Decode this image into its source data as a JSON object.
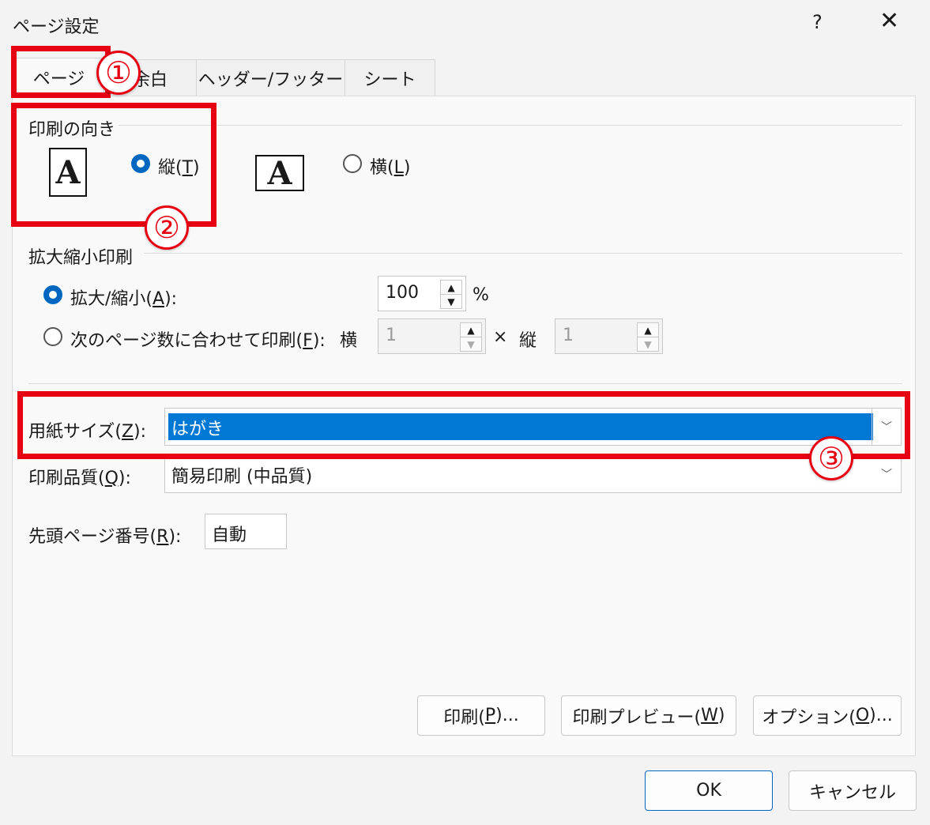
{
  "window": {
    "title": "ページ設定",
    "help": "?",
    "close": "✕"
  },
  "tabs": [
    {
      "label": "ページ"
    },
    {
      "label": "余白"
    },
    {
      "label": "ヘッダー/フッター"
    },
    {
      "label": "シート"
    }
  ],
  "orientation": {
    "section_label": "印刷の向き",
    "portrait_label": "縦(",
    "portrait_key": "T",
    "portrait_suffix": ")",
    "landscape_label": "横(",
    "landscape_key": "L",
    "landscape_suffix": ")",
    "icon_letter": "A"
  },
  "scaling": {
    "section_label": "拡大縮小印刷",
    "adjust_label": "拡大/縮小(",
    "adjust_key": "A",
    "adjust_suffix": "):",
    "adjust_value": "100",
    "percent": "%",
    "fit_label": "次のページ数に合わせて印刷(",
    "fit_key": "F",
    "fit_suffix": "):",
    "fit_wide_label": "横",
    "fit_wide_value": "1",
    "times": "×",
    "fit_tall_label": "縦",
    "fit_tall_value": "1"
  },
  "paper": {
    "size_label": "用紙サイズ(",
    "size_key": "Z",
    "size_suffix": "):",
    "size_value": "はがき",
    "quality_label": "印刷品質(",
    "quality_key": "Q",
    "quality_suffix": "):",
    "quality_value": "簡易印刷 (中品質)",
    "first_page_label": "先頭ページ番号(",
    "first_page_key": "R",
    "first_page_suffix": "):",
    "first_page_value": "自動"
  },
  "buttons": {
    "print": {
      "pre": "印刷(",
      "key": "P",
      "post": ")..."
    },
    "preview": {
      "pre": "印刷プレビュー(",
      "key": "W",
      "post": ")"
    },
    "options": {
      "pre": "オプション(",
      "key": "O",
      "post": ")..."
    },
    "ok": "OK",
    "cancel": "キャンセル"
  },
  "annotations": {
    "one": "①",
    "two": "②",
    "three": "③"
  },
  "colors": {
    "accent": "#0067c0",
    "annotation_red": "#e60012"
  }
}
